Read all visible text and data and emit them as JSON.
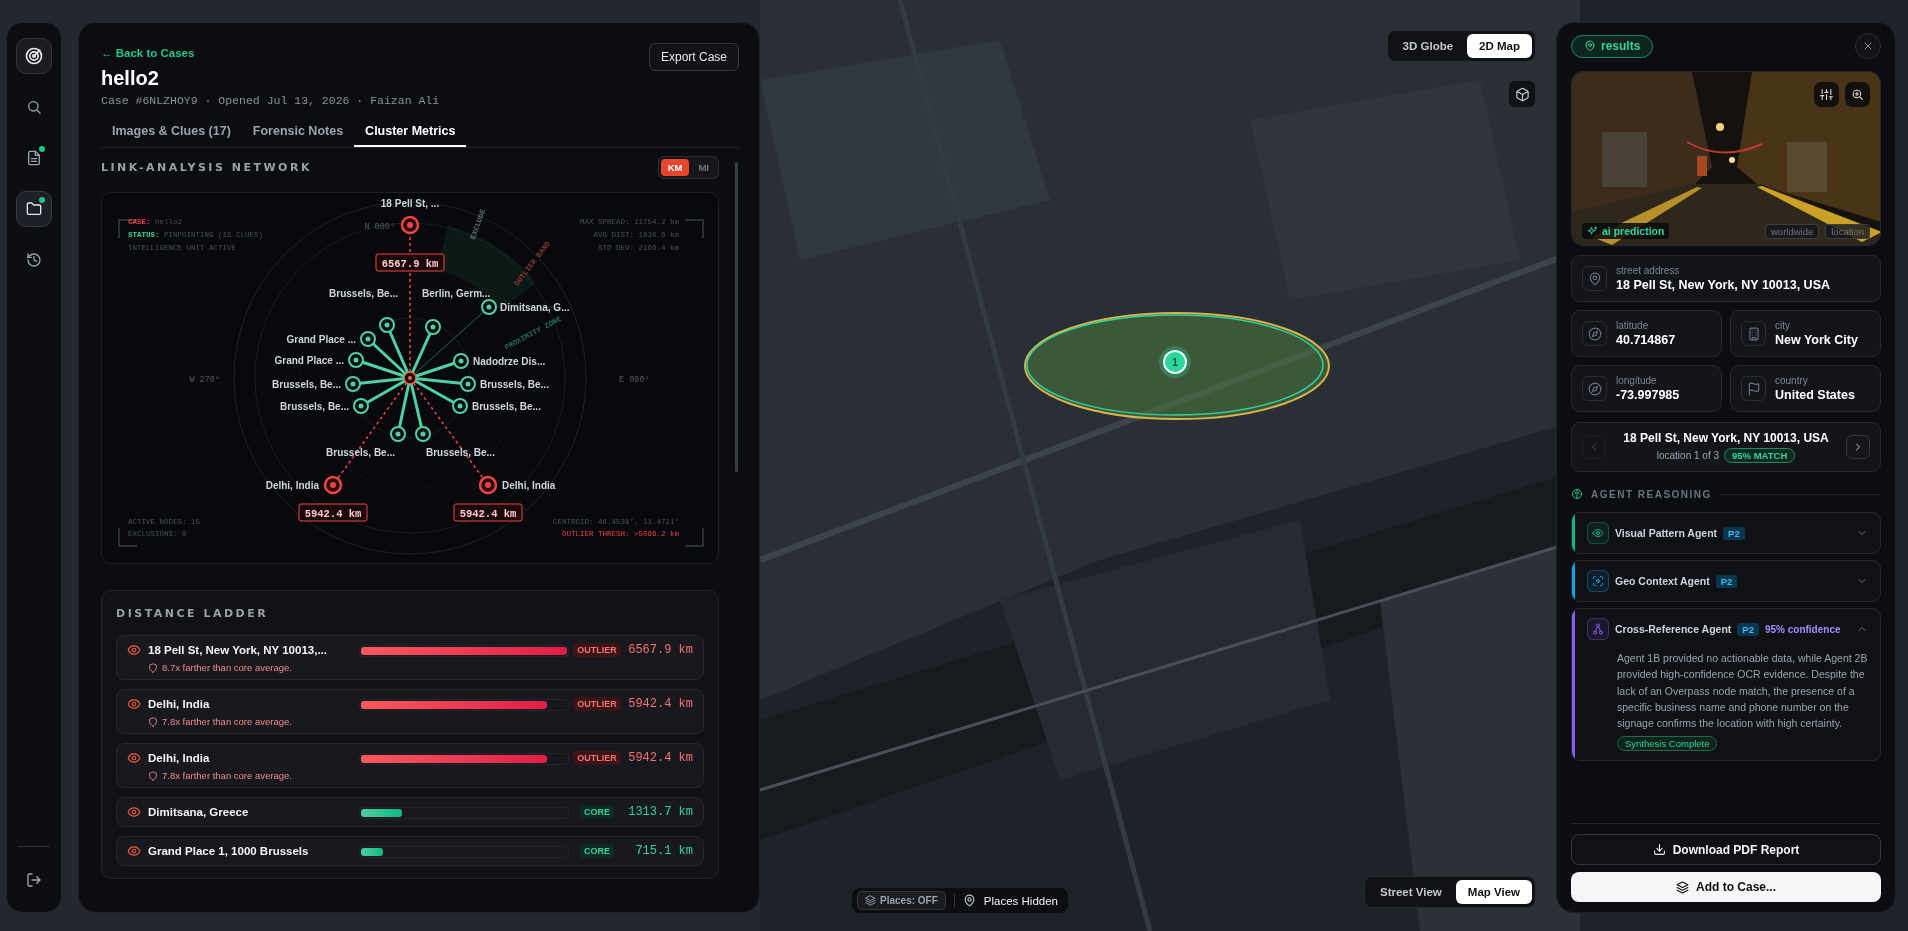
{
  "sidebar": {
    "items": [
      {
        "selected": false,
        "notification": false
      },
      {
        "selected": false,
        "notification": true
      },
      {
        "selected": true,
        "notification": true
      },
      {
        "selected": false,
        "notification": false
      }
    ]
  },
  "case": {
    "back_link": "← Back to Cases",
    "title": "hello2",
    "meta": "Case #6NLZHOY9 · Opened Jul 13, 2026 · Faizan Ali",
    "export_button": "Export Case"
  },
  "tabs": [
    {
      "label": "Images & Clues (17)",
      "selected": false
    },
    {
      "label": "Forensic Notes",
      "selected": false
    },
    {
      "label": "Cluster Metrics",
      "selected": true
    }
  ],
  "network": {
    "title": "LINK-ANALYSIS NETWORK",
    "units": [
      {
        "label": "KM",
        "selected": true
      },
      {
        "label": "MI",
        "selected": false
      }
    ],
    "hud_top_left": [
      {
        "key": "CASE:",
        "text": "hello2",
        "color": "#ef4444"
      },
      {
        "key": "STATUS:",
        "text": "PINPOINTING (15 CLUES)",
        "color": "#34d399"
      },
      {
        "text": "INTELLIGENCE UNIT ACTIVE"
      }
    ],
    "hud_top_right": [
      "MAX SPREAD: 11754.2 km",
      "AVG DIST: 1836.6 km",
      "STD DEV: 2166.4 km"
    ],
    "hud_bottom_left": [
      "ACTIVE NODES: 15",
      "EXCLUSIONS: 0"
    ],
    "hud_bottom_right": [
      {
        "text": "CENTROID: 46.4538°, 11.4721°",
        "alert": false
      },
      {
        "text": "OUTLIER THRESH: >5086.2 km",
        "alert": true
      }
    ],
    "compass": [
      "N 000°",
      "E 090°",
      "W 270°"
    ],
    "zones": [
      "OUTLIER BAND",
      "PROXIMITY ZONE",
      "EXCLUDE"
    ],
    "nodes": [
      {
        "label": "18 Pell St, ...",
        "kind": "outlier",
        "distance": "6567.9 km"
      },
      {
        "label": "Dimitsana, G...",
        "kind": "core",
        "weak_link": true
      },
      {
        "label": "Brussels, Be...",
        "kind": "core",
        "weak_link": false
      },
      {
        "label": "Berlin, Germ...",
        "kind": "core",
        "weak_link": false
      },
      {
        "label": "Grand Place ...",
        "kind": "core",
        "weak_link": false
      },
      {
        "label": "Grand Place ...",
        "kind": "core",
        "weak_link": false
      },
      {
        "label": "Nadodrze Dis...",
        "kind": "core",
        "weak_link": false
      },
      {
        "label": "Brussels, Be...",
        "kind": "core",
        "weak_link": false
      },
      {
        "label": "Brussels, Be...",
        "kind": "core",
        "weak_link": false
      },
      {
        "label": "Brussels, Be...",
        "kind": "core",
        "weak_link": false
      },
      {
        "label": "Brussels, Be...",
        "kind": "core",
        "weak_link": false
      },
      {
        "label": "Brussels, Be...",
        "kind": "core",
        "weak_link": false
      },
      {
        "label": "Brussels, Be...",
        "kind": "core",
        "weak_link": false
      },
      {
        "label": "Delhi, India",
        "kind": "outlier",
        "distance": "5942.4 km"
      },
      {
        "label": "Delhi, India",
        "kind": "outlier",
        "distance": "5942.4 km"
      }
    ]
  },
  "ladder": {
    "title": "DISTANCE LADDER",
    "rows": [
      {
        "name": "18 Pell St, New York, NY 10013,...",
        "note": "8.7x farther than core average.",
        "kind": "outlier",
        "badge": "OUTLIER",
        "distance": "6567.9 km",
        "level": 1.0
      },
      {
        "name": "Delhi, India",
        "note": "7.8x farther than core average.",
        "kind": "outlier",
        "badge": "OUTLIER",
        "distance": "5942.4 km",
        "level": 0.905
      },
      {
        "name": "Delhi, India",
        "note": "7.8x farther than core average.",
        "kind": "outlier",
        "badge": "OUTLIER",
        "distance": "5942.4 km",
        "level": 0.905
      },
      {
        "name": "Dimitsana, Greece",
        "kind": "core",
        "badge": "CORE",
        "distance": "1313.7 km",
        "level": 0.2
      },
      {
        "name": "Grand Place 1, 1000 Brussels",
        "kind": "core",
        "badge": "CORE",
        "distance": "715.1 km",
        "level": 0.109
      }
    ]
  },
  "map": {
    "views": [
      {
        "label": "3D Globe",
        "selected": false
      },
      {
        "label": "2D Map",
        "selected": true
      }
    ],
    "marker": "1",
    "places_toggle": "Places: OFF",
    "places_status": "Places Hidden",
    "modes": [
      {
        "label": "Street View",
        "selected": false
      },
      {
        "label": "Map View",
        "selected": true
      }
    ]
  },
  "results": {
    "tag": "results",
    "prediction": "ai prediction",
    "image_tags": [
      "worldwide",
      "location"
    ],
    "fields": [
      {
        "label": "street address",
        "value": "18 Pell St, New York, NY 10013, USA"
      },
      {
        "label": "latitude",
        "value": "40.714867"
      },
      {
        "label": "city",
        "value": "New York City"
      },
      {
        "label": "longitude",
        "value": "-73.997985"
      },
      {
        "label": "country",
        "value": "United States"
      }
    ],
    "location": {
      "title": "18 Pell St, New York, NY 10013, USA",
      "position": "location 1 of 3",
      "match": "95% MATCH",
      "prev_disabled": true,
      "next_disabled": false
    },
    "reasoning_title": "AGENT REASONING",
    "agents": [
      {
        "name": "Visual Pattern Agent",
        "priority": "P2",
        "color": "#10b981",
        "expanded": false
      },
      {
        "name": "Geo Context Agent",
        "priority": "P2",
        "color": "#0ea5e9",
        "expanded": false
      },
      {
        "name": "Cross-Reference Agent",
        "priority": "P2",
        "confidence": "95% confidence",
        "color": "#8b5cf6",
        "expanded": true,
        "body": "Agent 1B provided no actionable data, while Agent 2B provided high-confidence OCR evidence. Despite the lack of an Overpass node match, the presence of a specific business name and phone number on the signage confirms the location with high certainty.",
        "status": "Synthesis Complete"
      }
    ],
    "download_button": "Download PDF Report",
    "add_button": "Add to Case..."
  }
}
